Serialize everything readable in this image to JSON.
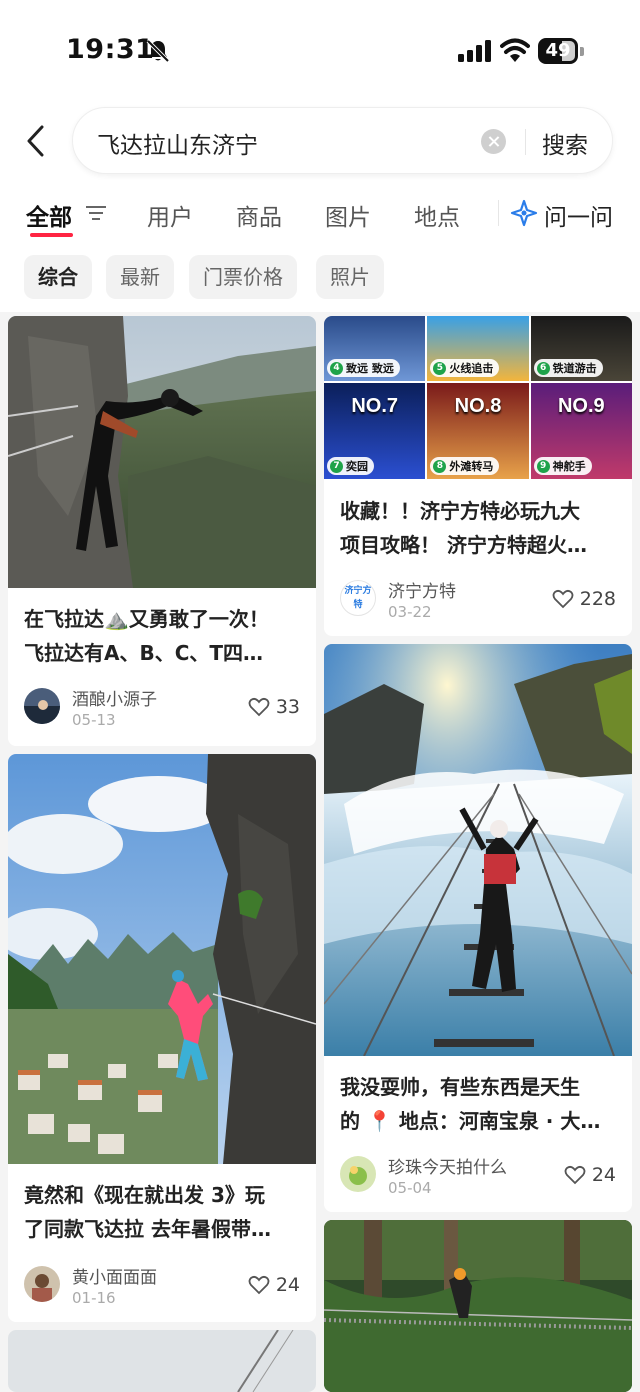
{
  "status": {
    "time": "19:31",
    "battery": "49"
  },
  "search": {
    "query": "飞达拉山东济宁",
    "button": "搜索"
  },
  "tabs": [
    {
      "label": "全部",
      "active": true
    },
    {
      "label": "用户"
    },
    {
      "label": "商品"
    },
    {
      "label": "图片"
    },
    {
      "label": "地点"
    }
  ],
  "ask": {
    "label": "问一问"
  },
  "chips": [
    {
      "label": "综合",
      "active": true
    },
    {
      "label": "最新"
    },
    {
      "label": "门票价格"
    },
    {
      "label": "照片"
    }
  ],
  "cards": [
    {
      "title_lines": [
        "在飞拉达⛰️又勇敢了一次！",
        "飞拉达有A、B、C、T四…"
      ],
      "author": "酒酿小源子",
      "date": "05-13",
      "likes": "33"
    },
    {
      "tiles": [
        {
          "no": "",
          "num": "4",
          "cap": "致远 致远"
        },
        {
          "no": "",
          "num": "5",
          "cap": "火线追击"
        },
        {
          "no": "",
          "num": "6",
          "cap": "铁道游击"
        },
        {
          "no": "NO.7",
          "num": "7",
          "cap": "奕园"
        },
        {
          "no": "NO.8",
          "num": "8",
          "cap": "外滩转马"
        },
        {
          "no": "NO.9",
          "num": "9",
          "cap": "神舵手"
        }
      ],
      "title_lines": [
        "收藏！！济宁方特必玩九大",
        "项目攻略！ 济宁方特超火…"
      ],
      "author": "济宁方特",
      "avatar_text": "济宁方特",
      "date": "03-22",
      "likes": "228"
    },
    {
      "title_lines": [
        "竟然和《现在就出发 3》玩",
        "了同款飞达拉 去年暑假带…"
      ],
      "author": "黄小面面面",
      "date": "01-16",
      "likes": "24"
    },
    {
      "title_lines": [
        "我没耍帅，有些东西是天生",
        "的 📍 地点：河南宝泉 · 大…"
      ],
      "author": "珍珠今天拍什么",
      "date": "05-04",
      "likes": "24"
    }
  ],
  "colors": {
    "accent": "#ff2442",
    "chip_bg": "#f2f2f2",
    "page_bg": "#f4f4f4"
  }
}
